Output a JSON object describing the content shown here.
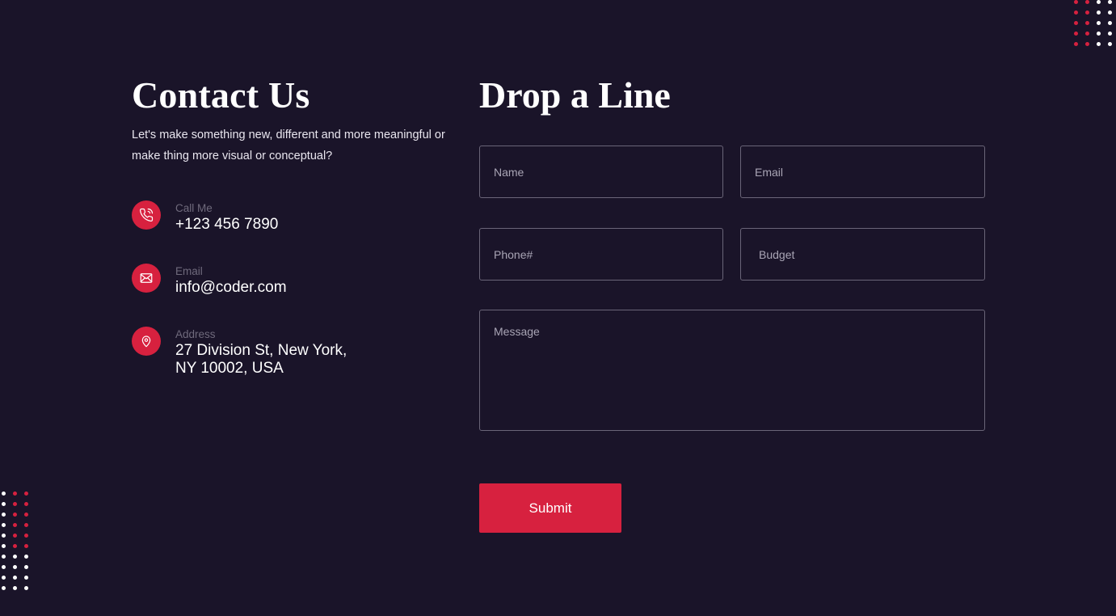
{
  "contact": {
    "title": "Contact Us",
    "description": "Let's make something new, different and more meaningful or make thing more visual or conceptual?",
    "items": [
      {
        "label": "Call Me",
        "value": "+123 456 7890",
        "icon": "phone-icon"
      },
      {
        "label": "Email",
        "value": "info@coder.com",
        "icon": "mail-icon"
      },
      {
        "label": "Address",
        "value": "27 Division St, New York, NY 10002, USA",
        "icon": "location-pin-icon"
      }
    ]
  },
  "form": {
    "title": "Drop a Line",
    "name_placeholder": "Name",
    "email_placeholder": "Email",
    "phone_placeholder": "Phone#",
    "budget_placeholder": "Budget",
    "message_placeholder": "Message",
    "submit_label": "Submit"
  },
  "colors": {
    "background": "#1a1429",
    "accent": "#d7213f",
    "dot_white": "#ffffff"
  }
}
